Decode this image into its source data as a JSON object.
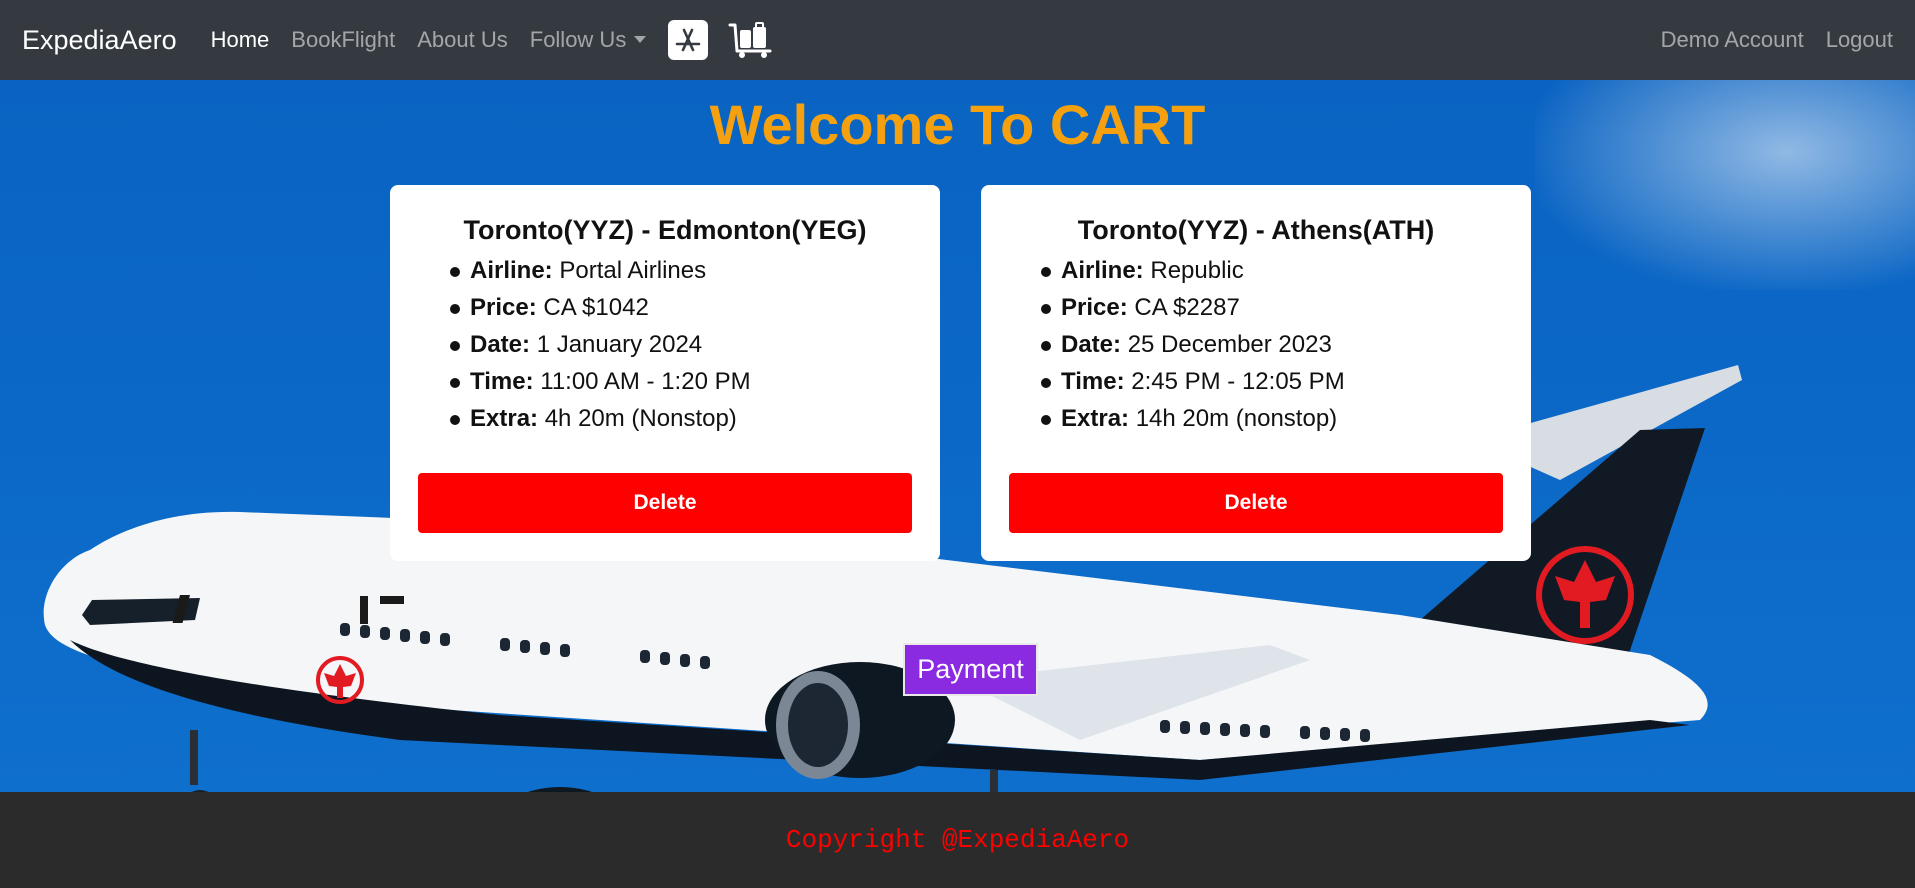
{
  "navbar": {
    "brand": "ExpediaAero",
    "links": {
      "home": "Home",
      "book_flight": "BookFlight",
      "about_us": "About Us",
      "follow_us": "Follow Us"
    },
    "icons": [
      "app-store-icon",
      "luggage-cart-icon"
    ],
    "right": {
      "account": "Demo Account",
      "logout": "Logout"
    }
  },
  "main": {
    "title": "Welcome To CART",
    "cards": [
      {
        "route": "Toronto(YYZ) - Edmonton(YEG)",
        "airline_label": "Airline:",
        "airline": "Portal Airlines",
        "price_label": "Price:",
        "price": "CA $1042",
        "date_label": "Date:",
        "date": "1 January 2024",
        "time_label": "Time:",
        "time": "11:00 AM - 1:20 PM",
        "extra_label": "Extra:",
        "extra": "4h 20m (Nonstop)",
        "delete_label": "Delete"
      },
      {
        "route": "Toronto(YYZ) - Athens(ATH)",
        "airline_label": "Airline:",
        "airline": "Republic",
        "price_label": "Price:",
        "price": "CA $2287",
        "date_label": "Date:",
        "date": "25 December 2023",
        "time_label": "Time:",
        "time": "2:45 PM - 12:05 PM",
        "extra_label": "Extra:",
        "extra": "14h 20m (nonstop)",
        "delete_label": "Delete"
      }
    ],
    "payment_label": "Payment"
  },
  "footer": {
    "copyright": "Copyright @ExpediaAero"
  },
  "colors": {
    "navbar_bg": "#343a40",
    "title": "#f5a10f",
    "delete": "#ff0000",
    "payment": "#8a2be2",
    "footer_bg": "#2b2b2b",
    "copyright": "#ff0000"
  }
}
